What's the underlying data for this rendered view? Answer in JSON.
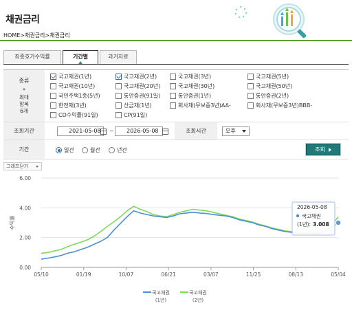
{
  "header": {
    "title": "채권금리",
    "breadcrumb": "HOME>채권금리>채권금리"
  },
  "tabs": [
    {
      "label": "최종호가수익률",
      "active": false
    },
    {
      "label": "기간별",
      "active": true
    },
    {
      "label": "과거자료",
      "active": false
    }
  ],
  "form": {
    "type_label": "종류",
    "type_note": "*\n최대\n항목\n6개",
    "checkboxes": [
      {
        "label": "국고채권(1년)",
        "checked": true
      },
      {
        "label": "국고채권(2년)",
        "checked": true
      },
      {
        "label": "국고채권(3년)",
        "checked": false
      },
      {
        "label": "국고채권(5년)",
        "checked": false
      },
      {
        "label": "국고채권(10년)",
        "checked": false
      },
      {
        "label": "국고채권(20년)",
        "checked": false
      },
      {
        "label": "국고채권(30년)",
        "checked": false
      },
      {
        "label": "국고채권(50년)",
        "checked": false
      },
      {
        "label": "국민주택1종(5년)",
        "checked": false
      },
      {
        "label": "통안증권(91일)",
        "checked": false
      },
      {
        "label": "통안증권(1년)",
        "checked": false
      },
      {
        "label": "통안증권(2년)",
        "checked": false
      },
      {
        "label": "한전채(3년)",
        "checked": false
      },
      {
        "label": "산금채(1년)",
        "checked": false
      },
      {
        "label": "회사채(무보증3년)AA-",
        "checked": false
      },
      {
        "label": "회사채(무보증3년)BBB-",
        "checked": false
      },
      {
        "label": "CD수익률(91일)",
        "checked": false
      },
      {
        "label": "CP(91일)",
        "checked": false
      }
    ],
    "period_label": "조회기간",
    "start_date": "2021-05-08",
    "end_date": "2026-05-08",
    "tilde": "~",
    "time_label": "조회시간",
    "time_value": "오후",
    "interval_label": "기간",
    "intervals": [
      {
        "label": "일간",
        "selected": true
      },
      {
        "label": "월간",
        "selected": false
      },
      {
        "label": "년간",
        "selected": false
      }
    ],
    "search_button": "조회"
  },
  "chart_toggle_label": "그래프닫기",
  "chart_data": {
    "type": "line",
    "ylabel": "수익률",
    "ylim": [
      0,
      6
    ],
    "yticks": [
      "0.00",
      "2.00",
      "4.00",
      "6.00"
    ],
    "xticks": [
      "05/10",
      "01/19",
      "10/07",
      "06/21",
      "03/07",
      "11/25",
      "08/13",
      "05/04"
    ],
    "grid": true,
    "legend": "bottom",
    "series": [
      {
        "name": "국고채권\n(1년)",
        "color": "#4a8fd6",
        "values": [
          0.55,
          0.62,
          0.7,
          0.8,
          0.95,
          1.05,
          1.2,
          1.35,
          1.55,
          1.75,
          2.0,
          2.5,
          2.95,
          3.4,
          3.8,
          3.65,
          3.55,
          3.45,
          3.4,
          3.35,
          3.45,
          3.6,
          3.65,
          3.7,
          3.65,
          3.62,
          3.55,
          3.5,
          3.45,
          3.35,
          3.2,
          3.1,
          3.0,
          2.85,
          2.75,
          2.6,
          2.5,
          2.4,
          2.35,
          2.3,
          2.3,
          2.32,
          2.3,
          2.45,
          2.7,
          3.0
        ]
      },
      {
        "name": "국고채권\n(2년)",
        "color": "#7ed957",
        "values": [
          0.95,
          1.0,
          1.1,
          1.2,
          1.4,
          1.55,
          1.7,
          1.85,
          2.1,
          2.4,
          2.75,
          3.05,
          3.4,
          3.8,
          4.1,
          3.9,
          3.75,
          3.55,
          3.45,
          3.4,
          3.55,
          3.7,
          3.8,
          3.9,
          3.85,
          3.8,
          3.7,
          3.6,
          3.5,
          3.4,
          3.25,
          3.15,
          3.05,
          2.9,
          2.78,
          2.65,
          2.55,
          2.45,
          2.4,
          2.35,
          2.35,
          2.4,
          2.38,
          2.5,
          2.8,
          3.4
        ]
      }
    ],
    "tooltip": {
      "date": "2026-05-08",
      "series": "국고채권\n(1년)",
      "value": "3.008"
    }
  }
}
